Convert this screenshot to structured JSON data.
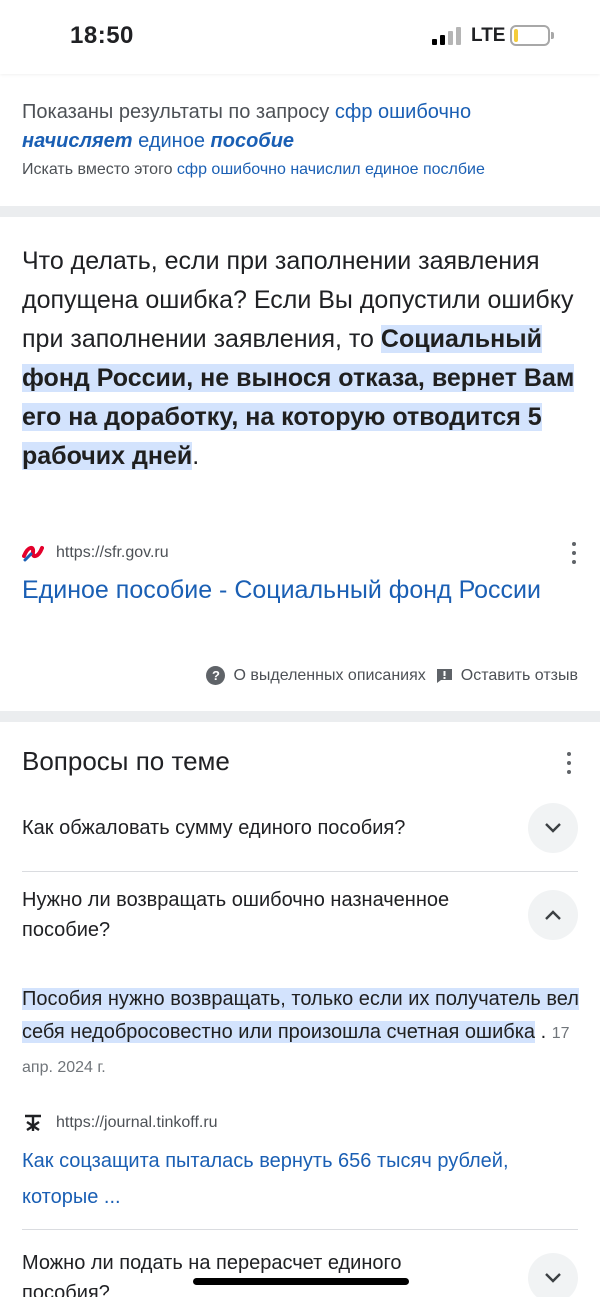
{
  "status_bar": {
    "time": "18:50",
    "network": "LTE",
    "signal_bars_active": 2,
    "signal_bars_total": 4,
    "battery_level": 0.12,
    "battery_color": "#f4cc3a"
  },
  "query": {
    "shown_prefix": "Показаны результаты по запросу",
    "corrected_parts": [
      "сфр ошибочно",
      "начисляет",
      "единое",
      "пособие"
    ],
    "instead_prefix": "Искать вместо этого",
    "original_query": "сфр ошибочно начислил единое послбие"
  },
  "featured_snippet": {
    "text_before": "Что делать, если при заполнении заявления допущена ошибка? Если Вы допустили ошибку при заполнении заявления, то ",
    "highlight": "Социальный фонд России, не вынося отказа, вернет Вам его на доработку, на которую отводится 5 рабочих дней",
    "text_after": ".",
    "source_url": "https://sfr.gov.ru",
    "title": "Единое пособие - Социальный фонд России"
  },
  "feedback": {
    "about_label": "О выделенных описаниях",
    "feedback_label": "Оставить отзыв"
  },
  "related_questions": {
    "title": "Вопросы по теме",
    "items": [
      {
        "question": "Как обжаловать сумму единого пособия?",
        "expanded": false
      },
      {
        "question": "Нужно ли возвращать ошибочно назначенное пособие?",
        "expanded": true
      },
      {
        "question": "Можно ли подать на перерасчет единого пособия?",
        "expanded": false
      }
    ],
    "answer": {
      "highlight": "Пособия нужно возвращать, только если их получатель вел себя недобросовестно или произошла счетная ошибка",
      "separator": ".",
      "date": "17 апр. 2024 г.",
      "source_url": "https://journal.tinkoff.ru",
      "title": "Как соцзащита пыталась вернуть 656 тысяч рублей, которые ..."
    }
  },
  "colors": {
    "link": "#1a5fb4",
    "highlight": "#d3e3fd",
    "separator": "#ebedef",
    "sfr_logo": "#e4002b"
  }
}
